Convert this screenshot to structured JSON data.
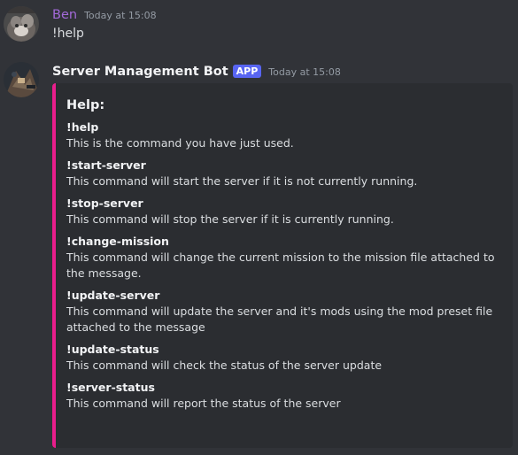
{
  "messages": [
    {
      "username": "Ben",
      "timestamp": "Today at 15:08",
      "content": "!help",
      "avatar_icon": "cat-avatar-icon",
      "username_color": "#a36ad9"
    },
    {
      "username": "Server Management Bot",
      "badge": "APP",
      "timestamp": "Today at 15:08",
      "avatar_icon": "bot-avatar-icon",
      "embed": {
        "accent_color": "#e91e8c",
        "title": "Help:",
        "fields": [
          {
            "name": "!help",
            "value": "This is the command you have just used."
          },
          {
            "name": "!start-server",
            "value": "This command will start the server if it is not currently running."
          },
          {
            "name": "!stop-server",
            "value": "This command will stop the server if it is currently running."
          },
          {
            "name": "!change-mission",
            "value": "This command will change the current mission to the mission file attached to the message."
          },
          {
            "name": "!update-server",
            "value": "This command will update the server and it's mods using the mod preset file attached to the message"
          },
          {
            "name": "!update-status",
            "value": "This command will check the status of the server update"
          },
          {
            "name": "!server-status",
            "value": "This command will report the status of the server"
          }
        ]
      }
    }
  ],
  "colors": {
    "background": "#313338",
    "embed_background": "#2b2d31",
    "badge": "#5865f2"
  }
}
